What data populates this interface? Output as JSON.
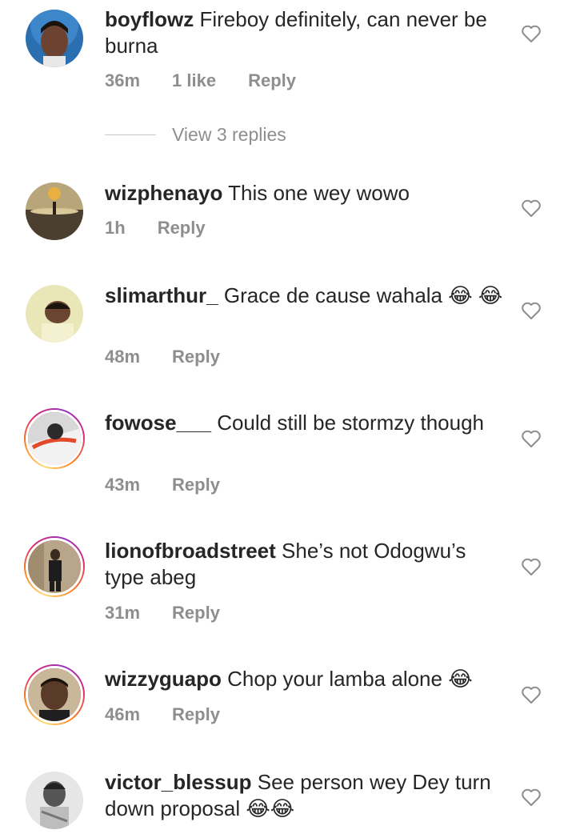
{
  "comments": [
    {
      "username": "boyflowz",
      "text": "Fireboy definitely, can never be burna",
      "time": "36m",
      "likes": "1 like",
      "reply": "Reply"
    },
    {
      "username": "wizphenayo",
      "text": "This one wey wowo",
      "time": "1h",
      "reply": "Reply"
    },
    {
      "username": "slimarthur_",
      "text": "Grace de cause wahala 😂 😂",
      "time": "48m",
      "reply": "Reply"
    },
    {
      "username": "fowose___",
      "text": "Could still be stormzy though",
      "time": "43m",
      "reply": "Reply"
    },
    {
      "username": "lionofbroadstreet",
      "text": "She’s not Odogwu’s type abeg",
      "time": "31m",
      "reply": "Reply"
    },
    {
      "username": "wizzyguapo",
      "text": "Chop your lamba alone 😂",
      "time": "46m",
      "reply": "Reply"
    },
    {
      "username": "victor_blessup",
      "text": "See person wey Dey turn down proposal 😂😂"
    }
  ],
  "view_replies": "View 3 replies",
  "icons": {
    "like": "heart-outline-icon"
  },
  "colors": {
    "text": "#262626",
    "secondary": "#8e8e8e",
    "story_ring": "#d62976"
  }
}
